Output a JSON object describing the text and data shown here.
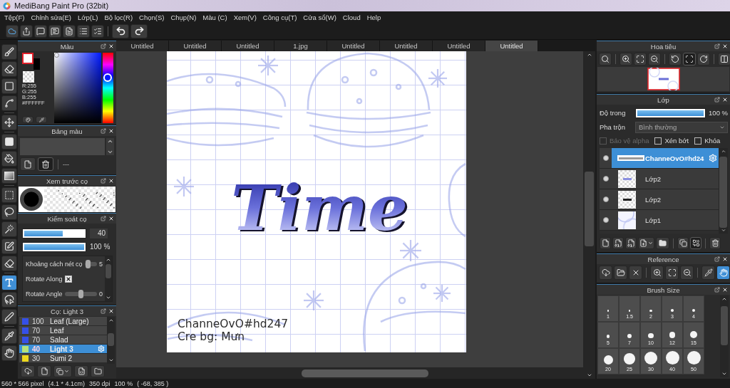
{
  "window": {
    "title": "MediBang Paint Pro (32bit)"
  },
  "menu": [
    "Tệp(F)",
    "Chỉnh sửa(E)",
    "Lớp(L)",
    "Bộ lọc(R)",
    "Chọn(S)",
    "Chụp(N)",
    "Màu (C)",
    "Xem(V)",
    "Công cụ(T)",
    "Cửa sổ(W)",
    "Cloud",
    "Help"
  ],
  "tools": [
    {
      "selected": false
    },
    {
      "selected": false
    },
    {
      "selected": false
    },
    {
      "selected": false
    },
    {
      "selected": false
    },
    {
      "selected": false
    },
    {
      "selected": false
    },
    {
      "selected": false
    },
    {
      "selected": false
    },
    {
      "selected": false
    },
    {
      "selected": false
    },
    {
      "selected": false
    },
    {
      "selected": false
    },
    {
      "selected": true
    },
    {
      "selected": false
    },
    {
      "selected": false
    },
    {
      "selected": false
    },
    {
      "selected": false
    }
  ],
  "color_panel": {
    "title": "Màu",
    "rgb": [
      "R:255",
      "G:255",
      "B:255"
    ],
    "hex": "#FFFFFF",
    "hue": {
      "level": 0.65
    }
  },
  "palette_panel": {
    "title": "Bảng màu",
    "palette_name": "---"
  },
  "brush_preview_panel": {
    "title": "Xem trước cọ"
  },
  "brush_control_panel": {
    "title": "Kiểm soát cọ",
    "size": {
      "level": 0.64,
      "value": "40"
    },
    "opacity": {
      "level": 1,
      "value": "100 %"
    },
    "options": [
      {
        "kind": "slider",
        "label": "Khoảng cách nét cọ",
        "level": 0.1,
        "value": "5"
      },
      {
        "kind": "checkbox",
        "label": "Rotate Along",
        "checked": true
      },
      {
        "kind": "slider",
        "label": "Rotate Angle",
        "level": 0.5,
        "value": "0"
      }
    ]
  },
  "brush_panel": {
    "title": "Cọ: Light 3",
    "brushes": [
      {
        "size": "100",
        "name": "Leaf (Large)",
        "color": "#3550e8",
        "selected": false
      },
      {
        "size": "70",
        "name": "Leaf",
        "color": "#3550e8",
        "selected": false
      },
      {
        "size": "70",
        "name": "Salad",
        "color": "#3550e8",
        "selected": false
      },
      {
        "size": "40",
        "name": "Light 3",
        "color": "#b6e27a",
        "selected": true
      },
      {
        "size": "30",
        "name": "Sumi 2",
        "color": "#ecd81e",
        "selected": false
      }
    ]
  },
  "tabs": [
    {
      "label": "Untitled",
      "selected": false
    },
    {
      "label": "Untitled",
      "selected": false
    },
    {
      "label": "Untitled",
      "selected": false
    },
    {
      "label": "1.jpg",
      "selected": false
    },
    {
      "label": "Untitled",
      "selected": false
    },
    {
      "label": "Untitled",
      "selected": false
    },
    {
      "label": "Untitled",
      "selected": false
    },
    {
      "label": "Untitled",
      "selected": true
    }
  ],
  "canvas": {
    "artwork_title": "Time",
    "credits": [
      "ChanneOvO#hd247",
      "Cre bg: Mưn"
    ]
  },
  "navigator_panel": {
    "title": "Hoa tiêu",
    "tools": [
      {
        "selected": false
      },
      {
        "selected": false
      },
      {
        "selected": false
      },
      {
        "selected": false
      },
      {
        "selected": false
      },
      {
        "selected": true
      },
      {
        "selected": false
      },
      {
        "selected": false
      }
    ]
  },
  "layer_panel": {
    "title": "Lớp",
    "opacity": {
      "label": "Độ trong",
      "level": 1,
      "value": "100 %"
    },
    "blend": {
      "label": "Pha trộn",
      "value": "Bình thường"
    },
    "options": [
      {
        "label": "Bảo vệ alpha",
        "checked": false,
        "disabled": true
      },
      {
        "label": "Xén bớt",
        "checked": false,
        "disabled": false
      },
      {
        "label": "Khóa",
        "checked": false,
        "disabled": false
      }
    ],
    "layers": [
      {
        "name": "ChanneOvO#hd24",
        "selected": true,
        "visible": true
      },
      {
        "name": "Lớp2",
        "selected": false,
        "visible": true
      },
      {
        "name": "Lớp2",
        "selected": false,
        "visible": true
      },
      {
        "name": "Lớp1",
        "selected": false,
        "visible": true
      }
    ]
  },
  "reference_panel": {
    "title": "Reference",
    "tools": [
      {
        "selected": false
      },
      {
        "selected": false
      },
      {
        "selected": false
      },
      {
        "selected": false
      },
      {
        "selected": false
      },
      {
        "selected": false
      },
      {
        "selected": false
      },
      {
        "selected": true
      }
    ]
  },
  "brush_size_panel": {
    "title": "Brush Size",
    "sizes": [
      "1",
      "1.5",
      "2",
      "3",
      "4",
      "5",
      "7",
      "10",
      "12",
      "15",
      "20",
      "25",
      "30",
      "40",
      "50"
    ]
  },
  "status_bar": [
    "560 * 566 pixel",
    "(4.1 * 4.1cm)",
    "350 dpi",
    "100 %",
    "( -68, 385 )"
  ]
}
